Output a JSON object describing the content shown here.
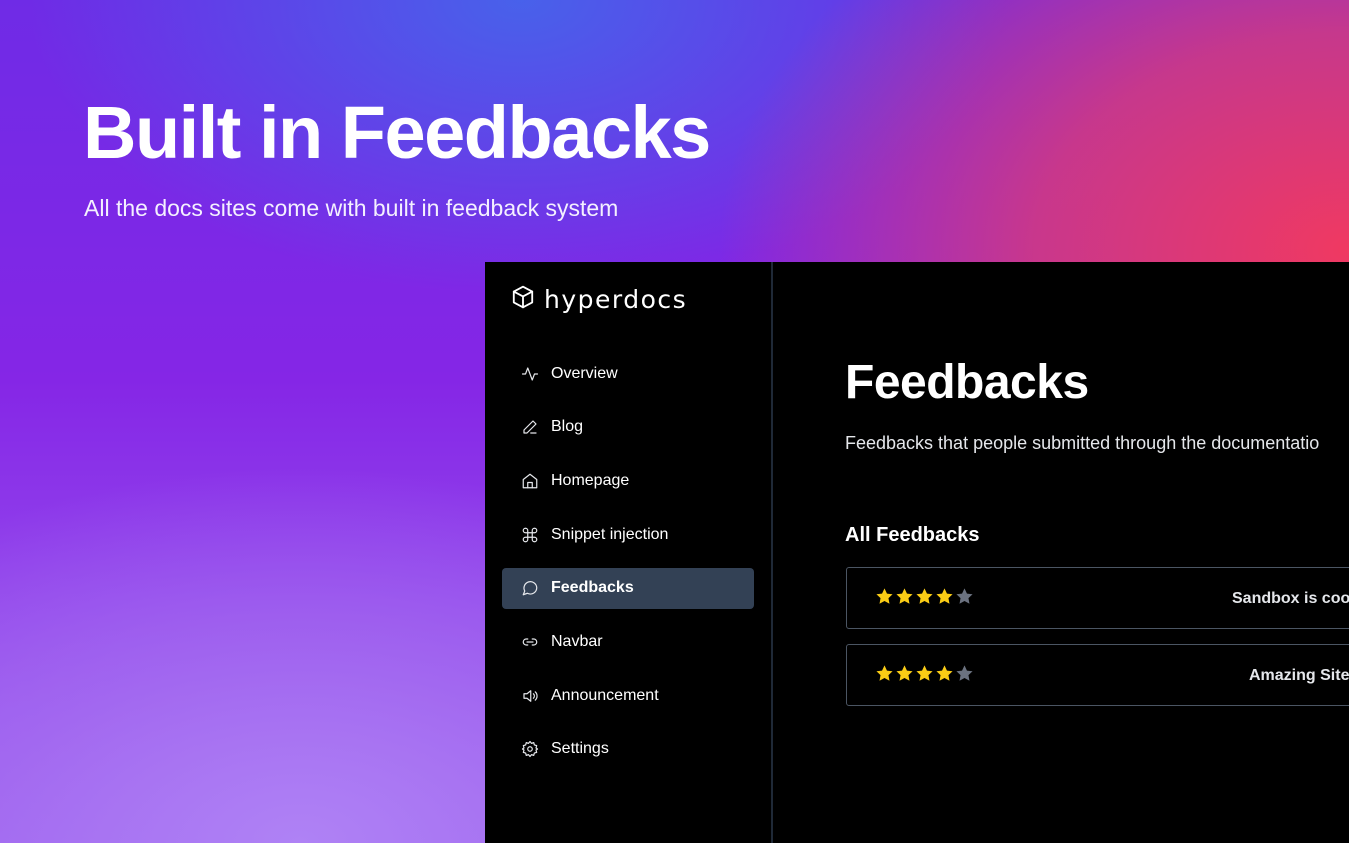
{
  "hero": {
    "title": "Built in Feedbacks",
    "subtitle": "All the docs sites come with built in feedback system"
  },
  "brand": {
    "name": "hyperdocs",
    "icon": "cube-icon"
  },
  "sidebar": {
    "items": [
      {
        "label": "Overview",
        "icon": "activity-icon",
        "active": false
      },
      {
        "label": "Blog",
        "icon": "pencil-icon",
        "active": false
      },
      {
        "label": "Homepage",
        "icon": "home-icon",
        "active": false
      },
      {
        "label": "Snippet injection",
        "icon": "command-icon",
        "active": false
      },
      {
        "label": "Feedbacks",
        "icon": "message-circle-icon",
        "active": true
      },
      {
        "label": "Navbar",
        "icon": "link-icon",
        "active": false
      },
      {
        "label": "Announcement",
        "icon": "speaker-icon",
        "active": false
      },
      {
        "label": "Settings",
        "icon": "gear-icon",
        "active": false
      }
    ]
  },
  "main": {
    "title": "Feedbacks",
    "description": "Feedbacks that people submitted through the documentatio",
    "section_title": "All Feedbacks",
    "feedbacks": [
      {
        "rating": 4,
        "max_rating": 5,
        "text": "Sandbox is coo"
      },
      {
        "rating": 4,
        "max_rating": 5,
        "text": "Amazing Site"
      }
    ]
  },
  "colors": {
    "star_filled": "#facc15",
    "star_empty": "#6b7280",
    "active_nav_bg": "#334155"
  }
}
